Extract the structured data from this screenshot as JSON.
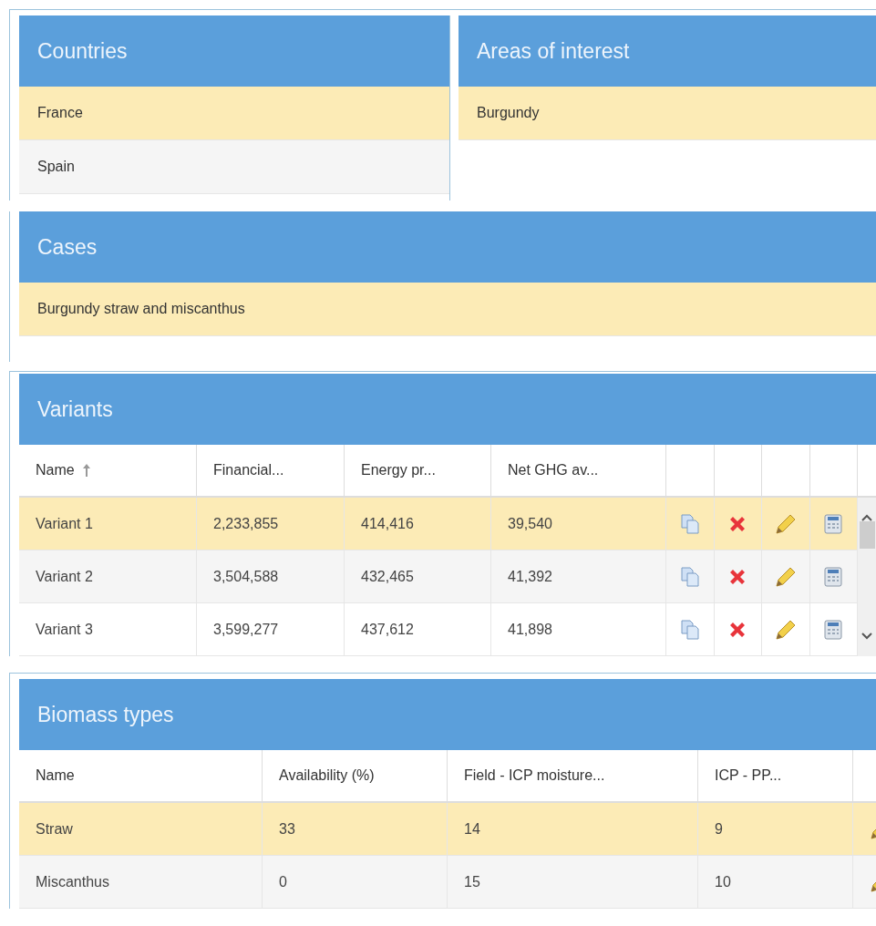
{
  "countries": {
    "title": "Countries",
    "rows": [
      {
        "label": "France",
        "selected": true
      },
      {
        "label": "Spain",
        "selected": false
      }
    ]
  },
  "areas_of_interest": {
    "title": "Areas of interest",
    "rows": [
      {
        "label": "Burgundy",
        "selected": true
      }
    ]
  },
  "cases": {
    "title": "Cases",
    "rows": [
      {
        "label": "Burgundy straw and miscanthus",
        "selected": true
      }
    ]
  },
  "variants": {
    "title": "Variants",
    "columns": [
      {
        "label": "Name",
        "sorted_ascending": true
      },
      {
        "label": "Financial..."
      },
      {
        "label": "Energy pr..."
      },
      {
        "label": "Net GHG av..."
      }
    ],
    "row_actions": [
      {
        "kind": "copy"
      },
      {
        "kind": "delete"
      },
      {
        "kind": "edit"
      },
      {
        "kind": "calculator"
      }
    ],
    "rows": [
      {
        "cells": [
          "Variant 1",
          "2,233,855",
          "414,416",
          "39,540"
        ],
        "selected": true
      },
      {
        "cells": [
          "Variant 2",
          "3,504,588",
          "432,465",
          "41,392"
        ],
        "selected": false
      },
      {
        "cells": [
          "Variant 3",
          "3,599,277",
          "437,612",
          "41,898"
        ],
        "selected": false
      }
    ]
  },
  "biomass_types": {
    "title": "Biomass types",
    "columns": [
      {
        "label": "Name"
      },
      {
        "label": "Availability (%)"
      },
      {
        "label": "Field - ICP moisture..."
      },
      {
        "label": "ICP - PP..."
      }
    ],
    "row_actions": [
      {
        "kind": "edit"
      }
    ],
    "rows": [
      {
        "cells": [
          "Straw",
          "33",
          "14",
          "9"
        ],
        "selected": true
      },
      {
        "cells": [
          "Miscanthus",
          "0",
          "15",
          "10"
        ],
        "selected": false
      }
    ]
  }
}
